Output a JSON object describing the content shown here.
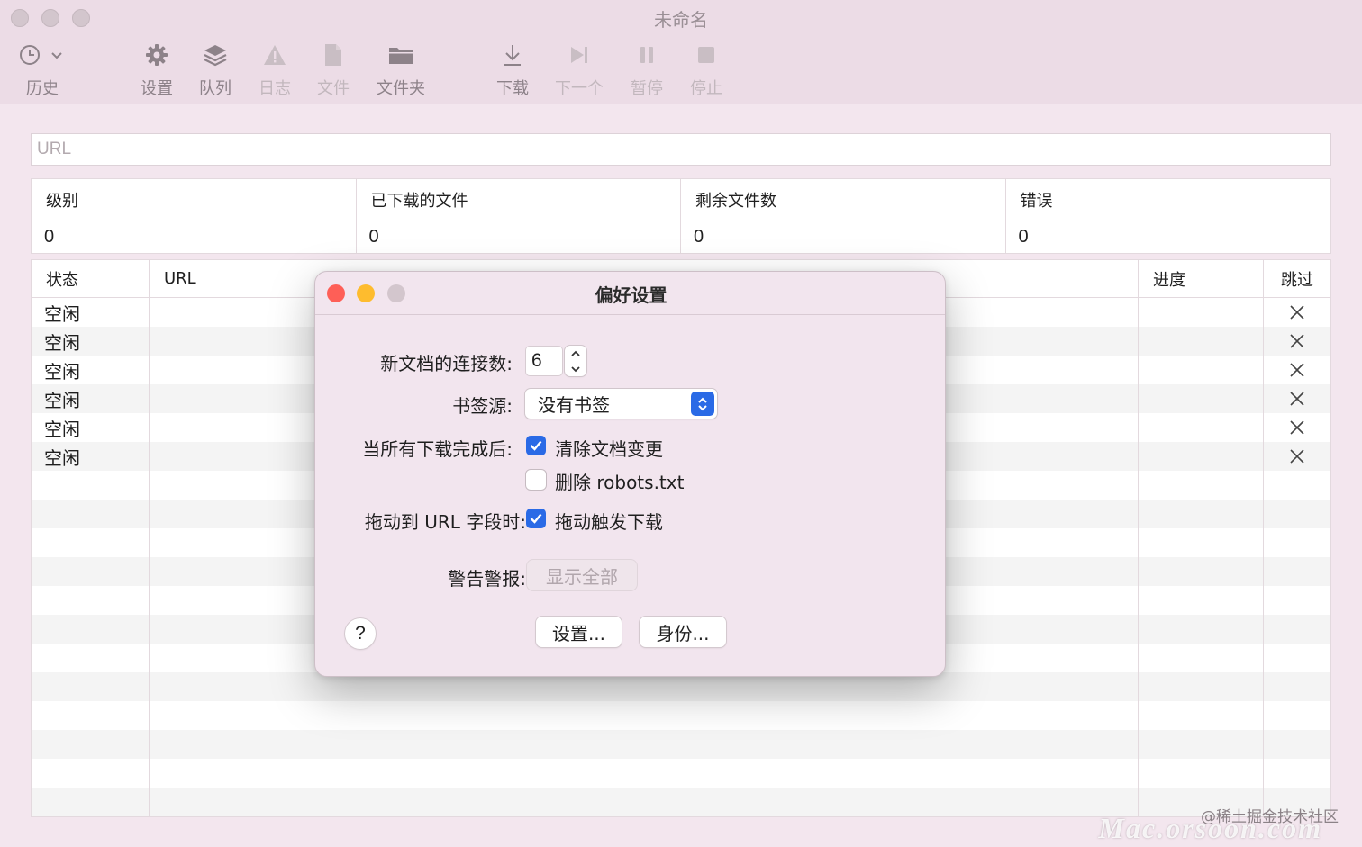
{
  "window": {
    "title": "未命名"
  },
  "toolbar": {
    "history": "历史",
    "settings": "设置",
    "queue": "队列",
    "log": "日志",
    "file": "文件",
    "folder": "文件夹",
    "download": "下载",
    "next": "下一个",
    "pause": "暂停",
    "stop": "停止"
  },
  "url_field": {
    "placeholder": "URL",
    "value": ""
  },
  "stats": {
    "headers": [
      "级别",
      "已下载的文件",
      "剩余文件数",
      "错误"
    ],
    "values": [
      "0",
      "0",
      "0",
      "0"
    ]
  },
  "tasks": {
    "headers": {
      "status": "状态",
      "url": "URL",
      "progress": "进度",
      "skip": "跳过"
    },
    "rows": [
      {
        "status": "空闲",
        "url": "",
        "progress": ""
      },
      {
        "status": "空闲",
        "url": "",
        "progress": ""
      },
      {
        "status": "空闲",
        "url": "",
        "progress": ""
      },
      {
        "status": "空闲",
        "url": "",
        "progress": ""
      },
      {
        "status": "空闲",
        "url": "",
        "progress": ""
      },
      {
        "status": "空闲",
        "url": "",
        "progress": ""
      }
    ]
  },
  "prefs": {
    "title": "偏好设置",
    "connections_label": "新文档的连接数:",
    "connections_value": "6",
    "bookmark_label": "书签源:",
    "bookmark_value": "没有书签",
    "after_label": "当所有下载完成后:",
    "clear_changes": "清除文档变更",
    "clear_changes_checked": true,
    "delete_robots": "删除 robots.txt",
    "delete_robots_checked": false,
    "drag_label": "拖动到 URL 字段时:",
    "drag_trigger": "拖动触发下载",
    "drag_trigger_checked": true,
    "warnings_label": "警告警报:",
    "show_all": "显示全部",
    "help": "?",
    "settings_button": "设置...",
    "identity_button": "身份..."
  },
  "watermark": {
    "line1": "@稀土掘金技术社区",
    "line2": "Mac.orsoon.com"
  },
  "colors": {
    "accent": "#2a6ae6",
    "close": "#fe5f57",
    "minimize": "#febc2e",
    "window_bg": "#f3e6ee"
  }
}
